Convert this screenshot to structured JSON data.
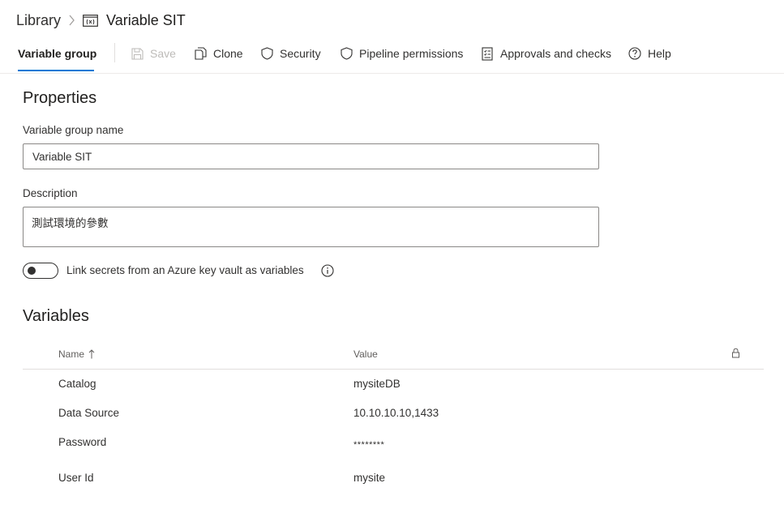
{
  "breadcrumb": {
    "library": "Library",
    "current": "Variable SIT"
  },
  "toolbar": {
    "tab": "Variable group",
    "save": "Save",
    "clone": "Clone",
    "security": "Security",
    "pipeline_permissions": "Pipeline permissions",
    "approvals": "Approvals and checks",
    "help": "Help"
  },
  "properties": {
    "heading": "Properties",
    "name_label": "Variable group name",
    "name_value": "Variable SIT",
    "desc_label": "Description",
    "desc_value": "測試環境的參數",
    "keyvault_label": "Link secrets from an Azure key vault as variables",
    "keyvault_enabled": false
  },
  "variables": {
    "heading": "Variables",
    "columns": {
      "name": "Name",
      "value": "Value"
    },
    "rows": [
      {
        "name": "Catalog",
        "value": "mysiteDB"
      },
      {
        "name": "Data Source",
        "value": "10.10.10.10,1433"
      },
      {
        "name": "Password",
        "value": "********"
      },
      {
        "name": "User Id",
        "value": "mysite"
      }
    ]
  },
  "colors": {
    "accent": "#0078d4",
    "text": "#323130",
    "disabled": "#bdbbb8"
  }
}
